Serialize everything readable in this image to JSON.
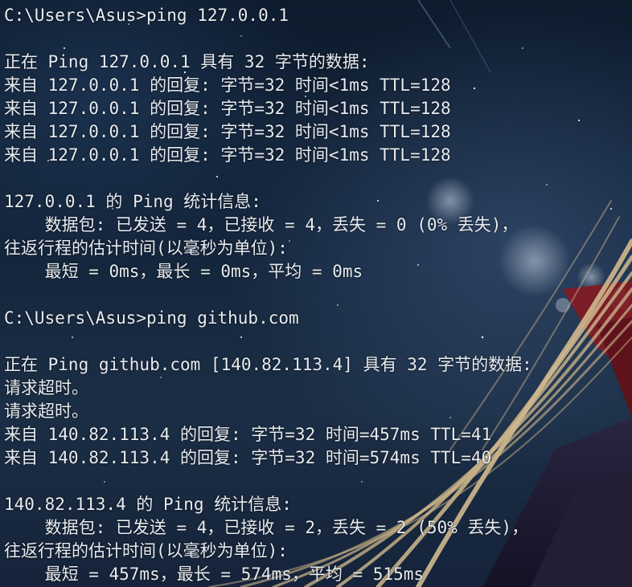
{
  "terminal": {
    "lines": [
      "C:\\Users\\Asus>ping 127.0.0.1",
      "",
      "正在 Ping 127.0.0.1 具有 32 字节的数据:",
      "来自 127.0.0.1 的回复: 字节=32 时间<1ms TTL=128",
      "来自 127.0.0.1 的回复: 字节=32 时间<1ms TTL=128",
      "来自 127.0.0.1 的回复: 字节=32 时间<1ms TTL=128",
      "来自 127.0.0.1 的回复: 字节=32 时间<1ms TTL=128",
      "",
      "127.0.0.1 的 Ping 统计信息:",
      "    数据包: 已发送 = 4，已接收 = 4，丢失 = 0 (0% 丢失)，",
      "往返行程的估计时间(以毫秒为单位):",
      "    最短 = 0ms，最长 = 0ms，平均 = 0ms",
      "",
      "C:\\Users\\Asus>ping github.com",
      "",
      "正在 Ping github.com [140.82.113.4] 具有 32 字节的数据:",
      "请求超时。",
      "请求超时。",
      "来自 140.82.113.4 的回复: 字节=32 时间=457ms TTL=41",
      "来自 140.82.113.4 的回复: 字节=32 时间=574ms TTL=40",
      "",
      "140.82.113.4 的 Ping 统计信息:",
      "    数据包: 已发送 = 4，已接收 = 2，丢失 = 2 (50% 丢失)，",
      "往返行程的估计时间(以毫秒为单位):",
      "    最短 = 457ms，最长 = 574ms，平均 = 515ms"
    ]
  },
  "colors": {
    "text": "#e8ecf1",
    "background": "#0d1b2d",
    "accent_red": "#8a1a22",
    "hair": "#d8c49a"
  }
}
